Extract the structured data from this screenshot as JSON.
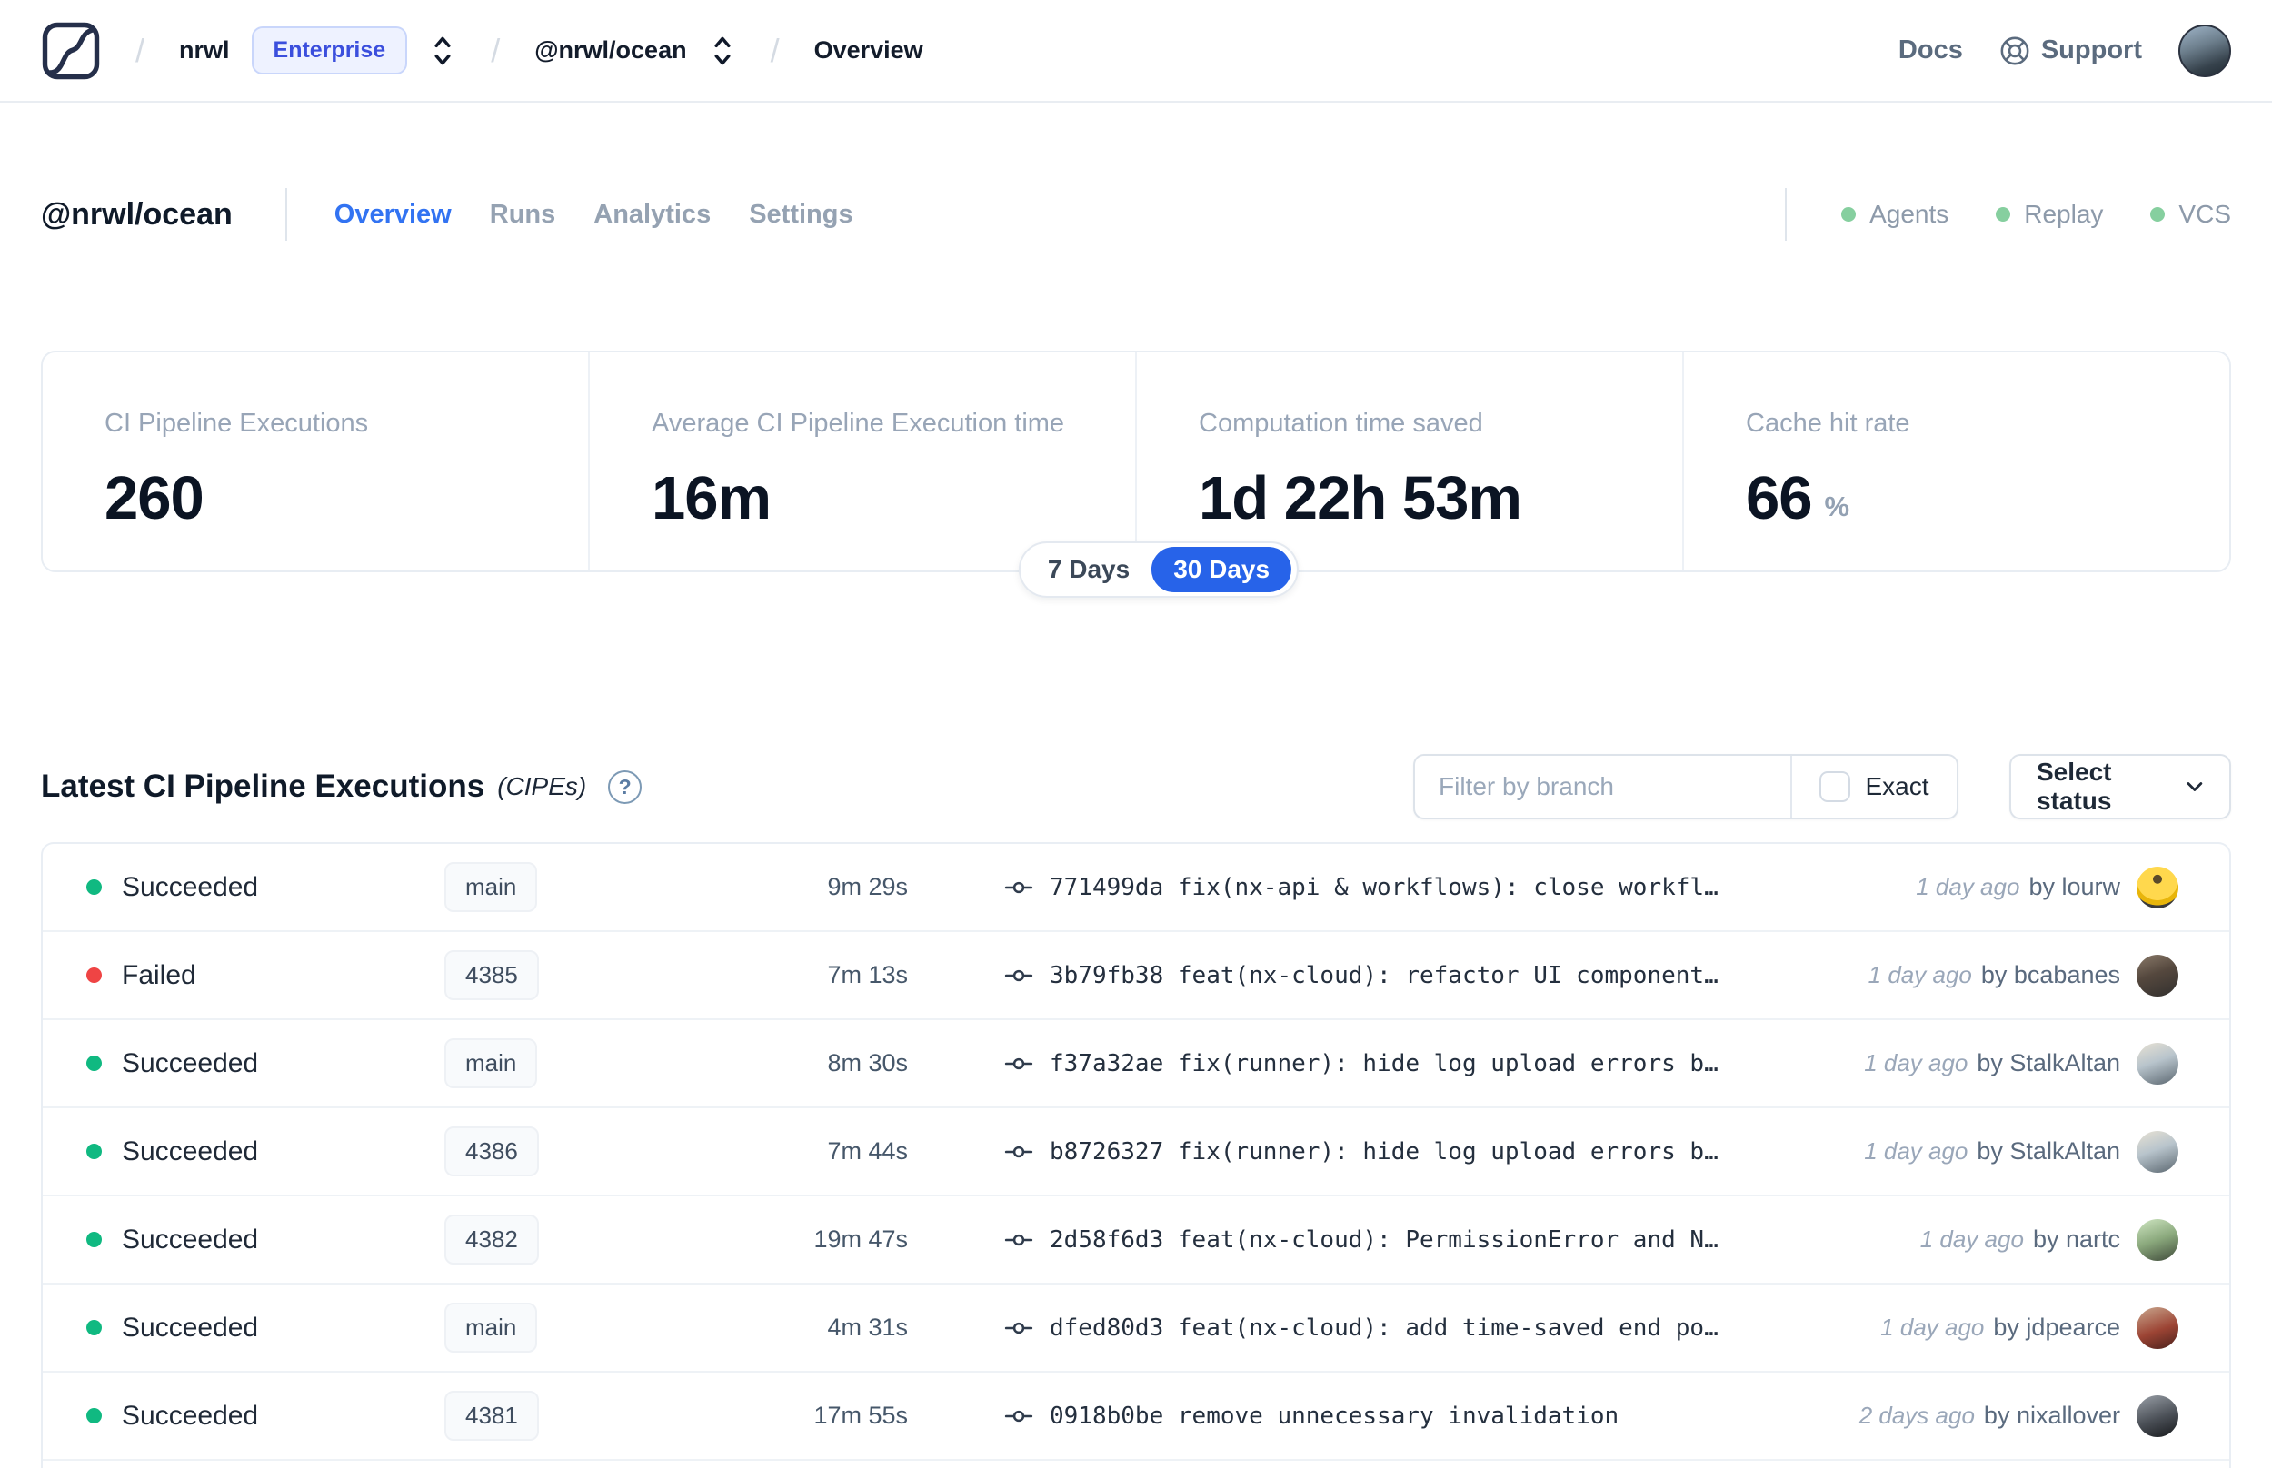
{
  "colors": {
    "accent_blue": "#3273f2",
    "toggle_active_blue": "#2763e9",
    "enterprise_badge_blue": "#3b4fdd",
    "success_green": "#10b981",
    "failed_red": "#ef4444",
    "env_dot_green": "#86cf9f"
  },
  "nav": {
    "breadcrumb": {
      "org": "nrwl",
      "org_badge": "Enterprise",
      "workspace": "@nrwl/ocean",
      "page": "Overview"
    },
    "docs_label": "Docs",
    "support_label": "Support"
  },
  "header": {
    "title": "@nrwl/ocean",
    "tabs": [
      {
        "label": "Overview",
        "active": true
      },
      {
        "label": "Runs",
        "active": false
      },
      {
        "label": "Analytics",
        "active": false
      },
      {
        "label": "Settings",
        "active": false
      }
    ],
    "env_statuses": [
      {
        "label": "Agents"
      },
      {
        "label": "Replay"
      },
      {
        "label": "VCS"
      }
    ]
  },
  "stats": {
    "cards": [
      {
        "label": "CI Pipeline Executions",
        "value": "260",
        "suffix": ""
      },
      {
        "label": "Average CI Pipeline Execution time",
        "value": "16m",
        "suffix": ""
      },
      {
        "label": "Computation time saved",
        "value": "1d 22h 53m",
        "suffix": ""
      },
      {
        "label": "Cache hit rate",
        "value": "66",
        "suffix": "%"
      }
    ],
    "range_toggle": {
      "options": [
        "7 Days",
        "30 Days"
      ],
      "selected": "30 Days"
    }
  },
  "cipe": {
    "title": "Latest CI Pipeline Executions",
    "title_suffix": "(CIPEs)",
    "filter": {
      "placeholder": "Filter by branch",
      "exact_label": "Exact"
    },
    "status_select_label": "Select status",
    "rows": [
      {
        "status": "Succeeded",
        "color": "green",
        "branch": "main",
        "duration": "9m 29s",
        "commit": "771499da",
        "message": "fix(nx-api & workflows): close workfl…",
        "time": "1 day ago",
        "author": "by lourw",
        "avatar": "av-lourw"
      },
      {
        "status": "Failed",
        "color": "red",
        "branch": "4385",
        "duration": "7m 13s",
        "commit": "3b79fb38",
        "message": "feat(nx-cloud): refactor UI component…",
        "time": "1 day ago",
        "author": "by bcabanes",
        "avatar": "av-bcabanes"
      },
      {
        "status": "Succeeded",
        "color": "green",
        "branch": "main",
        "duration": "8m 30s",
        "commit": "f37a32ae",
        "message": "fix(runner): hide log upload errors b…",
        "time": "1 day ago",
        "author": "by StalkAltan",
        "avatar": "av-stalkaltan"
      },
      {
        "status": "Succeeded",
        "color": "green",
        "branch": "4386",
        "duration": "7m 44s",
        "commit": "b8726327",
        "message": "fix(runner): hide log upload errors b…",
        "time": "1 day ago",
        "author": "by StalkAltan",
        "avatar": "av-stalkaltan"
      },
      {
        "status": "Succeeded",
        "color": "green",
        "branch": "4382",
        "duration": "19m 47s",
        "commit": "2d58f6d3",
        "message": "feat(nx-cloud): PermissionError and N…",
        "time": "1 day ago",
        "author": "by nartc",
        "avatar": "av-nartc"
      },
      {
        "status": "Succeeded",
        "color": "green",
        "branch": "main",
        "duration": "4m 31s",
        "commit": "dfed80d3",
        "message": "feat(nx-cloud): add time-saved end po…",
        "time": "1 day ago",
        "author": "by jdpearce",
        "avatar": "av-jdpearce"
      },
      {
        "status": "Succeeded",
        "color": "green",
        "branch": "4381",
        "duration": "17m 55s",
        "commit": "0918b0be",
        "message": "remove unnecessary invalidation",
        "time": "2 days ago",
        "author": "by nixallover",
        "avatar": "av-nixallover"
      }
    ]
  }
}
